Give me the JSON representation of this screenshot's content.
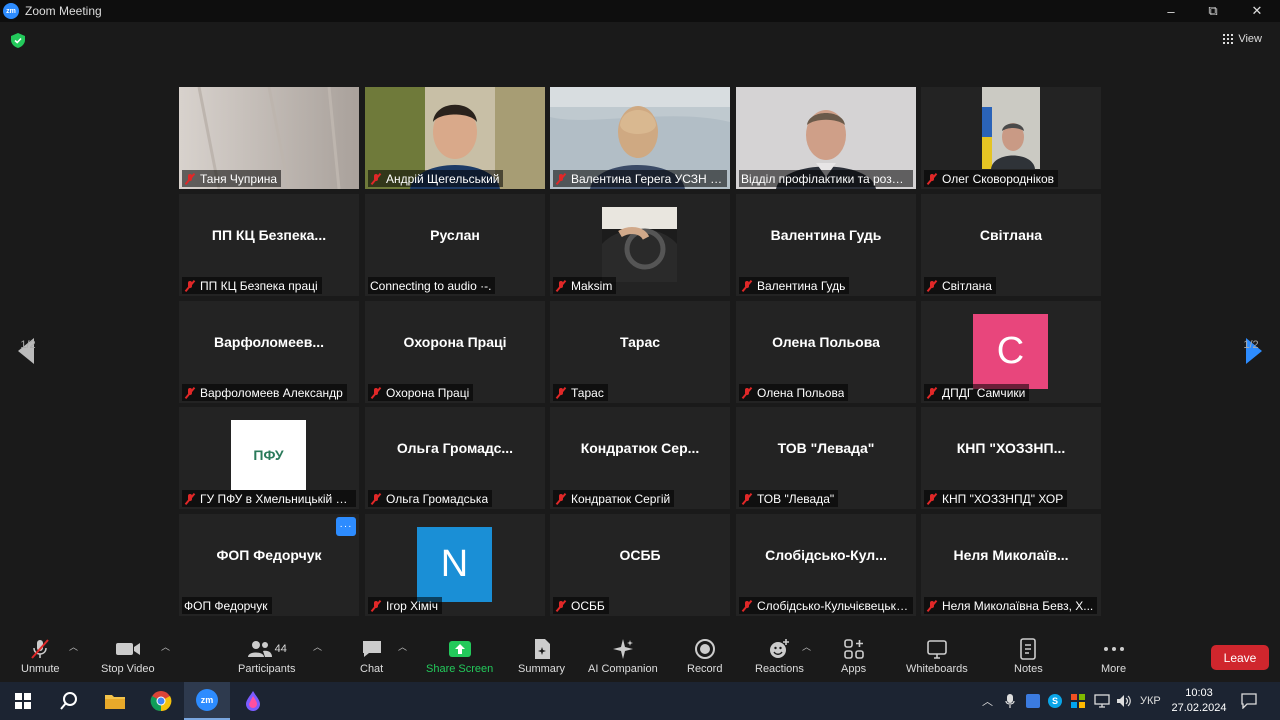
{
  "window": {
    "title": "Zoom Meeting",
    "controls": {
      "minimize": "–",
      "restore": "⧉",
      "close": "✕"
    }
  },
  "header": {
    "view_label": "View"
  },
  "pager": {
    "left": "1/2",
    "right": "1/2"
  },
  "tiles": [
    {
      "name": "",
      "label": "Таня Чуприна",
      "muted": true,
      "video": "room-wall"
    },
    {
      "name": "",
      "label": "Андрій Щегельський",
      "muted": true,
      "video": "man-office"
    },
    {
      "name": "",
      "label": "Валентина Герега УСЗН К...",
      "muted": true,
      "video": "woman-back"
    },
    {
      "name": "",
      "label": "Відділ профілактики та розслі...",
      "muted": false,
      "video": "man-grey",
      "active": true
    },
    {
      "name": "",
      "label": "Олег Сковородніков",
      "muted": true,
      "video": "man-flag"
    },
    {
      "name": "ПП КЦ Безпека...",
      "label": "ПП КЦ Безпека праці",
      "muted": true
    },
    {
      "name": "Руслан",
      "label": "Connecting to audio ·-.",
      "muted": false
    },
    {
      "name": "",
      "label": "Maksim",
      "muted": true,
      "video": "car"
    },
    {
      "name": "Валентина Гудь",
      "label": "Валентина Гудь",
      "muted": true
    },
    {
      "name": "Світлана",
      "label": "Світлана",
      "muted": true
    },
    {
      "name": "Варфоломеев...",
      "label": "Варфоломеев Александр",
      "muted": true
    },
    {
      "name": "Охорона Праці",
      "label": "Охорона Праці",
      "muted": true
    },
    {
      "name": "Тарас",
      "label": "Тарас",
      "muted": true
    },
    {
      "name": "Олена Польова",
      "label": "Олена Польова",
      "muted": true
    },
    {
      "name": "",
      "label": "ДПДГ Самчики",
      "muted": true,
      "avatar": "C",
      "avatar_color": "#e8467c"
    },
    {
      "name": "",
      "label": "ГУ ПФУ в Хмельницькій о...",
      "muted": true,
      "logo": "ПФУ"
    },
    {
      "name": "Ольга Громадс...",
      "label": "Ольга Громадська",
      "muted": true
    },
    {
      "name": "Кондратюк Сер...",
      "label": "Кондратюк Сергій",
      "muted": true
    },
    {
      "name": "ТОВ \"Левада\"",
      "label": "ТОВ \"Левада\"",
      "muted": true
    },
    {
      "name": "КНП \"ХОЗЗНП...",
      "label": "КНП \"ХОЗЗНПД\" ХОР",
      "muted": true
    },
    {
      "name": "ФОП Федорчук",
      "label": "ФОП Федорчук",
      "muted": false,
      "more": "···"
    },
    {
      "name": "",
      "label": "Ігор Хіміч",
      "muted": true,
      "avatar": "N",
      "avatar_color": "#1a8fd6"
    },
    {
      "name": "ОСББ",
      "label": "ОСББ",
      "muted": true
    },
    {
      "name": "Слобідсько-Кул...",
      "label": "Слобідсько-Кульчієвецька...",
      "muted": true
    },
    {
      "name": "Неля Миколаїв...",
      "label": "Неля Миколаївна Бевз, Х...",
      "muted": true
    }
  ],
  "toolbar": {
    "unmute": "Unmute",
    "stop_video": "Stop Video",
    "participants": "Participants",
    "participants_count": "44",
    "chat": "Chat",
    "share_screen": "Share Screen",
    "summary": "Summary",
    "ai_companion": "AI Companion",
    "record": "Record",
    "reactions": "Reactions",
    "apps": "Apps",
    "whiteboards": "Whiteboards",
    "notes": "Notes",
    "more": "More",
    "leave": "Leave"
  },
  "colors": {
    "accent": "#2d8cff",
    "active_speaker": "#b7d44a",
    "leave": "#d0262d",
    "share": "#23c95b"
  },
  "taskbar": {
    "language": "УКР",
    "time": "10:03",
    "date": "27.02.2024"
  }
}
